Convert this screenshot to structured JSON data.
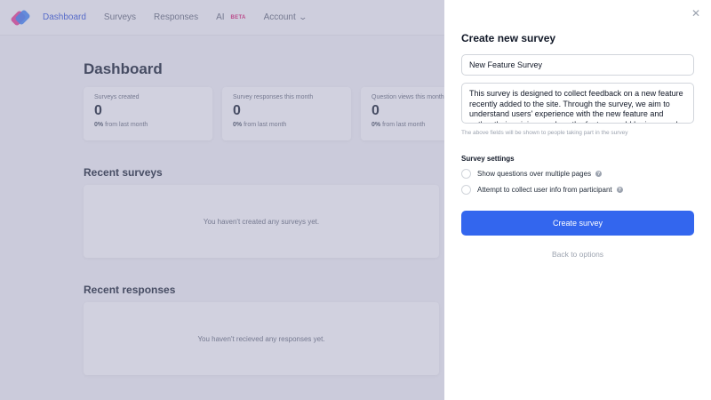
{
  "nav": {
    "items": [
      {
        "label": "Dashboard"
      },
      {
        "label": "Surveys"
      },
      {
        "label": "Responses"
      },
      {
        "label": "AI",
        "badge": "BETA"
      },
      {
        "label": "Account"
      }
    ]
  },
  "dashboard": {
    "title": "Dashboard",
    "stats": [
      {
        "label": "Surveys created",
        "value": "0",
        "change_pct": "0%",
        "change_text": " from last month"
      },
      {
        "label": "Survey responses this month",
        "value": "0",
        "change_pct": "0%",
        "change_text": " from last month"
      },
      {
        "label": "Question views this month",
        "value": "0",
        "change_pct": "0%",
        "change_text": " from last month"
      }
    ],
    "recent_surveys": {
      "title": "Recent surveys",
      "empty": "You haven't created any surveys yet."
    },
    "recent_responses": {
      "title": "Recent responses",
      "empty": "You haven't recieved any responses yet."
    }
  },
  "drawer": {
    "title": "Create new survey",
    "name_value": "New Feature Survey",
    "description_value": "This survey is designed to collect feedback on a new feature recently added to the site. Through the survey, we aim to understand users' experience with the new feature and gather their opinions on how the feature could be improved.",
    "hint": "The above fields will be shown to people taking part in the survey",
    "settings_title": "Survey settings",
    "options": [
      {
        "label": "Show questions over multiple pages"
      },
      {
        "label": "Attempt to collect user info from participant"
      }
    ],
    "create_label": "Create survey",
    "back_label": "Back to options"
  },
  "colors": {
    "primary": "#3366ee",
    "nav_active": "#3b5bdb",
    "beta": "#db2777"
  },
  "icons": {
    "close": "close-icon",
    "help": "help-icon",
    "chevron": "chevron-down-icon",
    "logo": "logo"
  }
}
